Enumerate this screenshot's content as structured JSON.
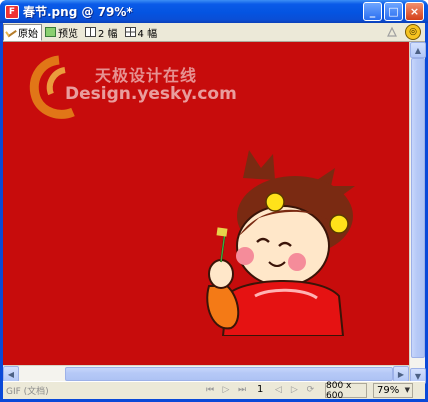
{
  "window": {
    "title": "春节.png @ 79%*",
    "app_icon_glyph": "F",
    "buttons": {
      "minimize": "_",
      "maximize": "□",
      "close": "×"
    }
  },
  "toolbar": {
    "tabs": [
      {
        "label": "原始",
        "icon": "pencil-icon",
        "active": true
      },
      {
        "label": "预览",
        "icon": "preview-icon",
        "active": false
      },
      {
        "label": "2 幅",
        "icon": "two-up-icon",
        "active": false
      },
      {
        "label": "4 幅",
        "icon": "four-up-icon",
        "active": false
      }
    ],
    "right_icons": [
      "quality-icon",
      "options-icon"
    ],
    "options_glyph": "◎"
  },
  "canvas": {
    "background_color": "#c70c0c",
    "watermark_cn": "天极设计在线",
    "watermark_en": "Design.yesky.com"
  },
  "status": {
    "format": "GIF (文档)",
    "frame": "1",
    "document_size": "800 x 600",
    "zoom": "79%"
  },
  "colors": {
    "title_bar": "#0a5ae8",
    "canvas_red": "#c70c0c",
    "chrome": "#ece9d8"
  }
}
